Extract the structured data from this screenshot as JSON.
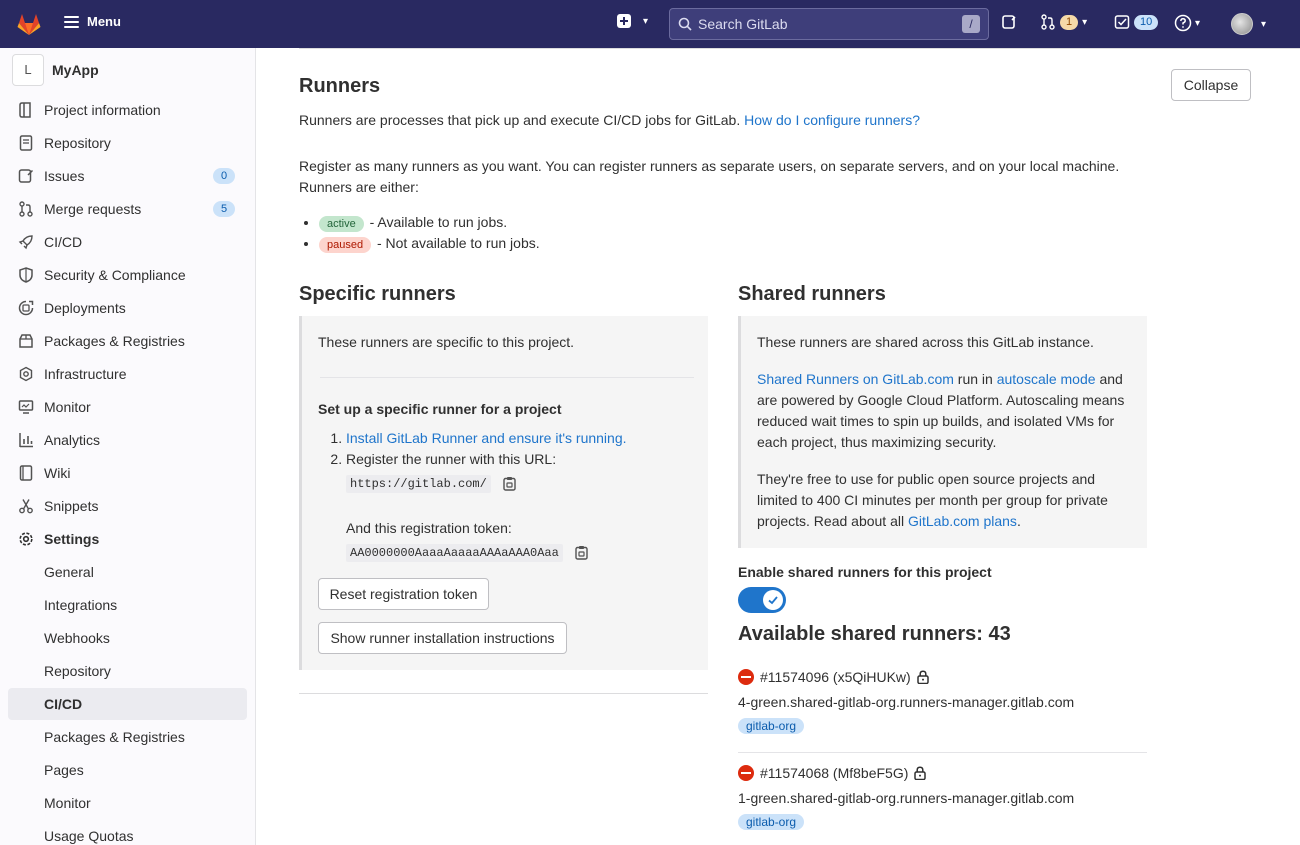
{
  "topbar": {
    "menu_label": "Menu",
    "search_placeholder": "Search GitLab",
    "search_shortcut": "/",
    "merge_requests_count": "1",
    "todos_count": "10"
  },
  "sidebar": {
    "project_initial": "L",
    "project_name": "MyApp",
    "items": [
      {
        "label": "Project information",
        "icon": "info-icon"
      },
      {
        "label": "Repository",
        "icon": "book-icon"
      },
      {
        "label": "Issues",
        "icon": "issues-icon",
        "count": "0"
      },
      {
        "label": "Merge requests",
        "icon": "merge-request-icon",
        "count": "5"
      },
      {
        "label": "CI/CD",
        "icon": "rocket-icon"
      },
      {
        "label": "Security & Compliance",
        "icon": "shield-icon"
      },
      {
        "label": "Deployments",
        "icon": "deployments-icon"
      },
      {
        "label": "Packages & Registries",
        "icon": "package-icon"
      },
      {
        "label": "Infrastructure",
        "icon": "cloud-gear-icon"
      },
      {
        "label": "Monitor",
        "icon": "monitor-icon"
      },
      {
        "label": "Analytics",
        "icon": "chart-icon"
      },
      {
        "label": "Wiki",
        "icon": "wiki-icon"
      },
      {
        "label": "Snippets",
        "icon": "scissors-icon"
      },
      {
        "label": "Settings",
        "icon": "gear-icon"
      }
    ],
    "settings_sub": [
      "General",
      "Integrations",
      "Webhooks",
      "Repository",
      "CI/CD",
      "Packages & Registries",
      "Pages",
      "Monitor",
      "Usage Quotas"
    ]
  },
  "runners": {
    "title": "Runners",
    "collapse_label": "Collapse",
    "intro": "Runners are processes that pick up and execute CI/CD jobs for GitLab.",
    "intro_link": "How do I configure runners?",
    "register_line1": "Register as many runners as you want. You can register runners as separate users, on separate servers, and on your local machine.",
    "register_line2": "Runners are either:",
    "active_pill": "active",
    "active_text": "- Available to run jobs.",
    "paused_pill": "paused",
    "paused_text": "- Not available to run jobs."
  },
  "specific": {
    "title": "Specific runners",
    "desc": "These runners are specific to this project.",
    "setup_title": "Set up a specific runner for a project",
    "step1_link": "Install GitLab Runner and ensure it's running.",
    "step2": "Register the runner with this URL:",
    "url": "https://gitlab.com/",
    "token_label": "And this registration token:",
    "token": "AA0000000AaaaAaaaaAAAaAAA0Aaa",
    "reset_button": "Reset registration token",
    "show_button": "Show runner installation instructions"
  },
  "shared": {
    "title": "Shared runners",
    "desc": "These runners are shared across this GitLab instance.",
    "link1": "Shared Runners on GitLab.com",
    "text1": "run in",
    "link2": "autoscale mode",
    "text2": "and",
    "text3": "are powered by Google Cloud Platform. Autoscaling means",
    "text4": "reduced wait times to spin up builds, and isolated VMs for",
    "text5": "each project, thus maximizing security.",
    "free1": "They're free to use for public open source projects and",
    "free2": "limited to 400 CI minutes per month per group for private",
    "free3": "projects. Read about all",
    "plans_link": "GitLab.com plans",
    "enable_label": "Enable shared runners for this project",
    "enabled": true,
    "available_title": "Available shared runners: 43",
    "runners": [
      {
        "id": "#11574096 (x5QiHUKw)",
        "host": "4-green.shared-gitlab-org.runners-manager.gitlab.com",
        "tag": "gitlab-org"
      },
      {
        "id": "#11574068 (Mf8beF5G)",
        "host": "1-green.shared-gitlab-org.runners-manager.gitlab.com",
        "tag": "gitlab-org"
      }
    ]
  }
}
